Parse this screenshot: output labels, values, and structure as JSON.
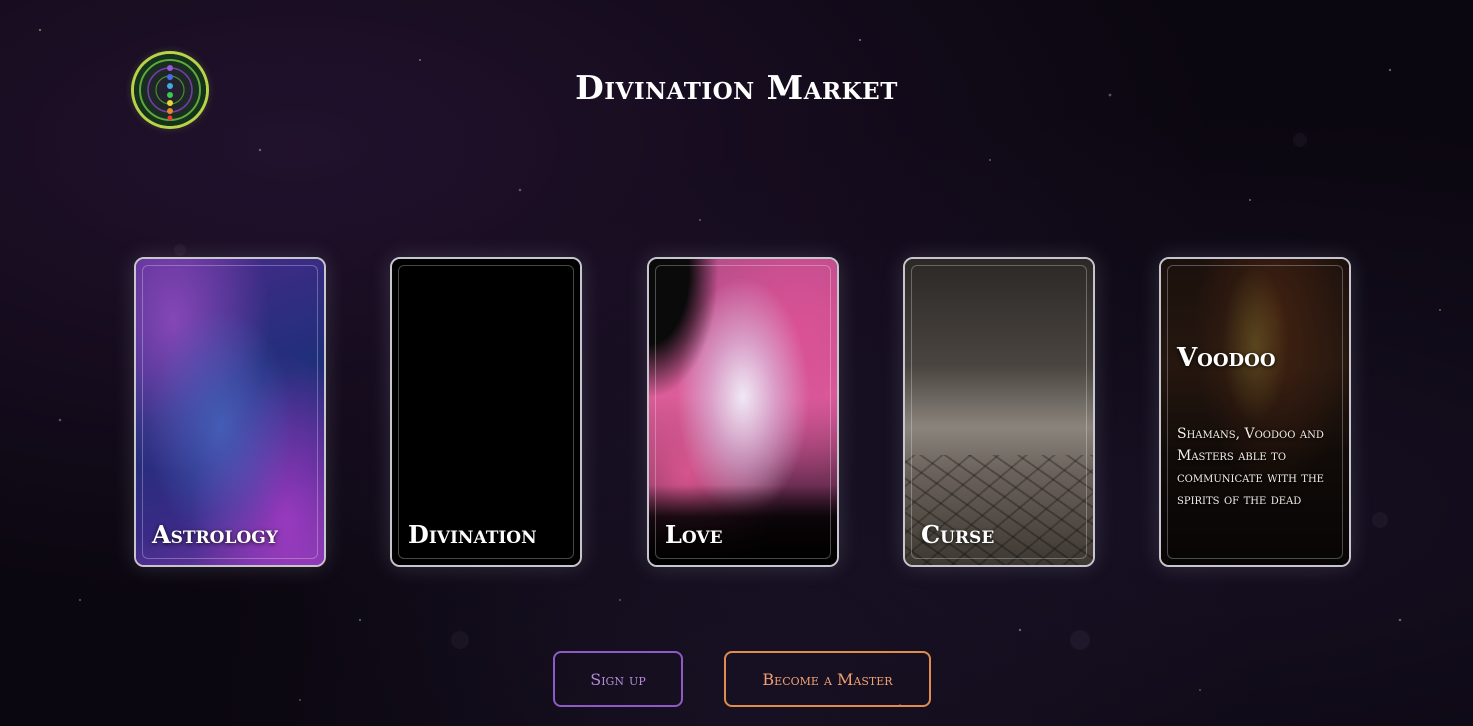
{
  "header": {
    "title": "Divination Market",
    "logo_icon": "chakra-logo-icon"
  },
  "cards": [
    {
      "id": "astrology",
      "label": "Astrology"
    },
    {
      "id": "divination",
      "label": "Divination"
    },
    {
      "id": "love",
      "label": "Love"
    },
    {
      "id": "curse",
      "label": "Curse"
    },
    {
      "id": "voodoo",
      "label": "Voodoo",
      "description": "Shamans, Voodoo and Masters able to communicate with the spirits of the dead"
    }
  ],
  "actions": {
    "signup_label": "Sign up",
    "master_label": "Become a Master"
  },
  "colors": {
    "background": "#0b0710",
    "signup_accent": "#8e5bc6",
    "master_accent": "#e08c4c",
    "logo_ring": "#b9d24a"
  }
}
